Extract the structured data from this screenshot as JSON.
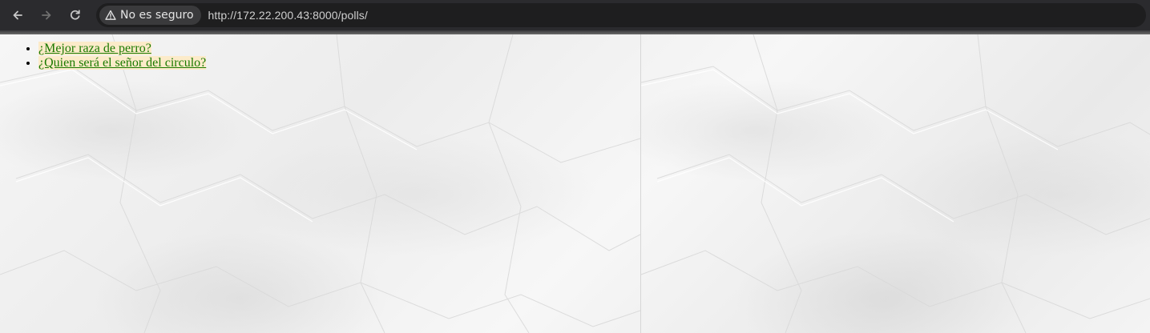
{
  "browser": {
    "security_label": "No es seguro",
    "url": "http://172.22.200.43:8000/polls/"
  },
  "icons": {
    "back": "arrow-left-icon",
    "forward": "arrow-right-icon",
    "reload": "reload-icon",
    "security": "warning-triangle-icon"
  },
  "polls": [
    {
      "question": "¿Mejor raza de perro?"
    },
    {
      "question": "¿Quien será el señor del circulo?"
    }
  ],
  "colors": {
    "link": "#1a7a00",
    "link_highlight": "#fcebc9",
    "chrome_dark": "#2b2b2e"
  }
}
